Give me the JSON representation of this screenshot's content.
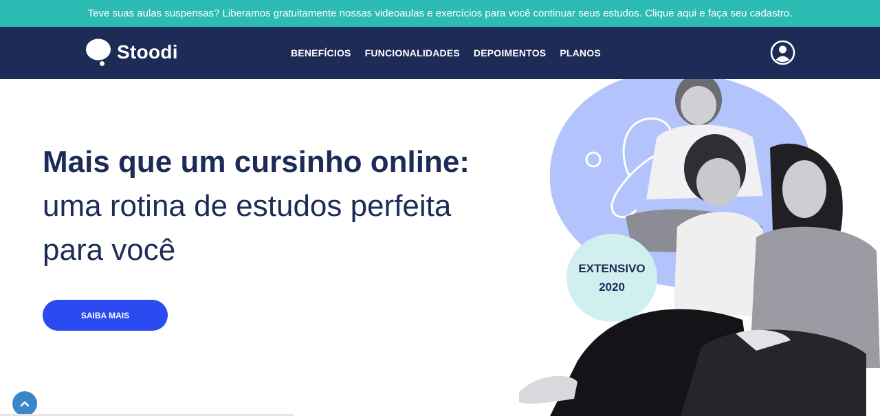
{
  "promo": {
    "text": "Teve suas aulas suspensas? Liberamos gratuitamente nossas videoaulas e exercícios para você continuar seus estudos. Clique aqui e faça seu cadastro."
  },
  "header": {
    "logo_text": "Stoodi",
    "nav": [
      {
        "label": "BENEFÍCIOS"
      },
      {
        "label": "FUNCIONALIDADES"
      },
      {
        "label": "DEPOIMENTOS"
      },
      {
        "label": "PLANOS"
      }
    ],
    "user_icon": "user-circle-icon"
  },
  "hero": {
    "title_bold": "Mais que um cursinho online:",
    "title_line2": "uma rotina de estudos perfeita",
    "title_line3": "para você",
    "cta_label": "SAIBA MAIS",
    "badge_line1": "EXTENSIVO",
    "badge_line2": "2020"
  },
  "colors": {
    "promo_bg": "#2cbcb4",
    "nav_bg": "#1d2b57",
    "cta_bg": "#2b4bf0",
    "blob": "#b3c3fb",
    "badge_bg": "#d2eff0",
    "title": "#1d2b57"
  }
}
